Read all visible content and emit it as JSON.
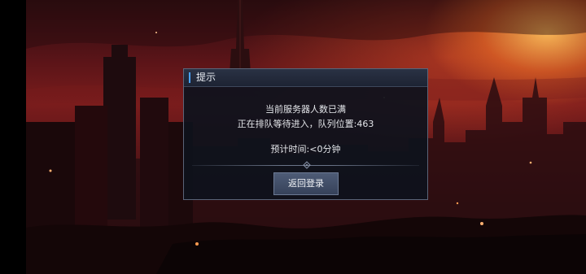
{
  "dialog": {
    "title": "提示",
    "message_line1": "当前服务器人数已满",
    "message_line2": "正在排队等待进入，队列位置:463",
    "eta_text": "预计时间:<0分钟",
    "button_label": "返回登录"
  },
  "colors": {
    "accent": "#4aa3ff",
    "dialog_bg": "#0e121c",
    "button_bg": "#44506a",
    "sky_glow": "#ffbe5a",
    "sky_red": "#7a1c1c"
  },
  "icons": {
    "divider": "diamond-ornament-icon"
  }
}
